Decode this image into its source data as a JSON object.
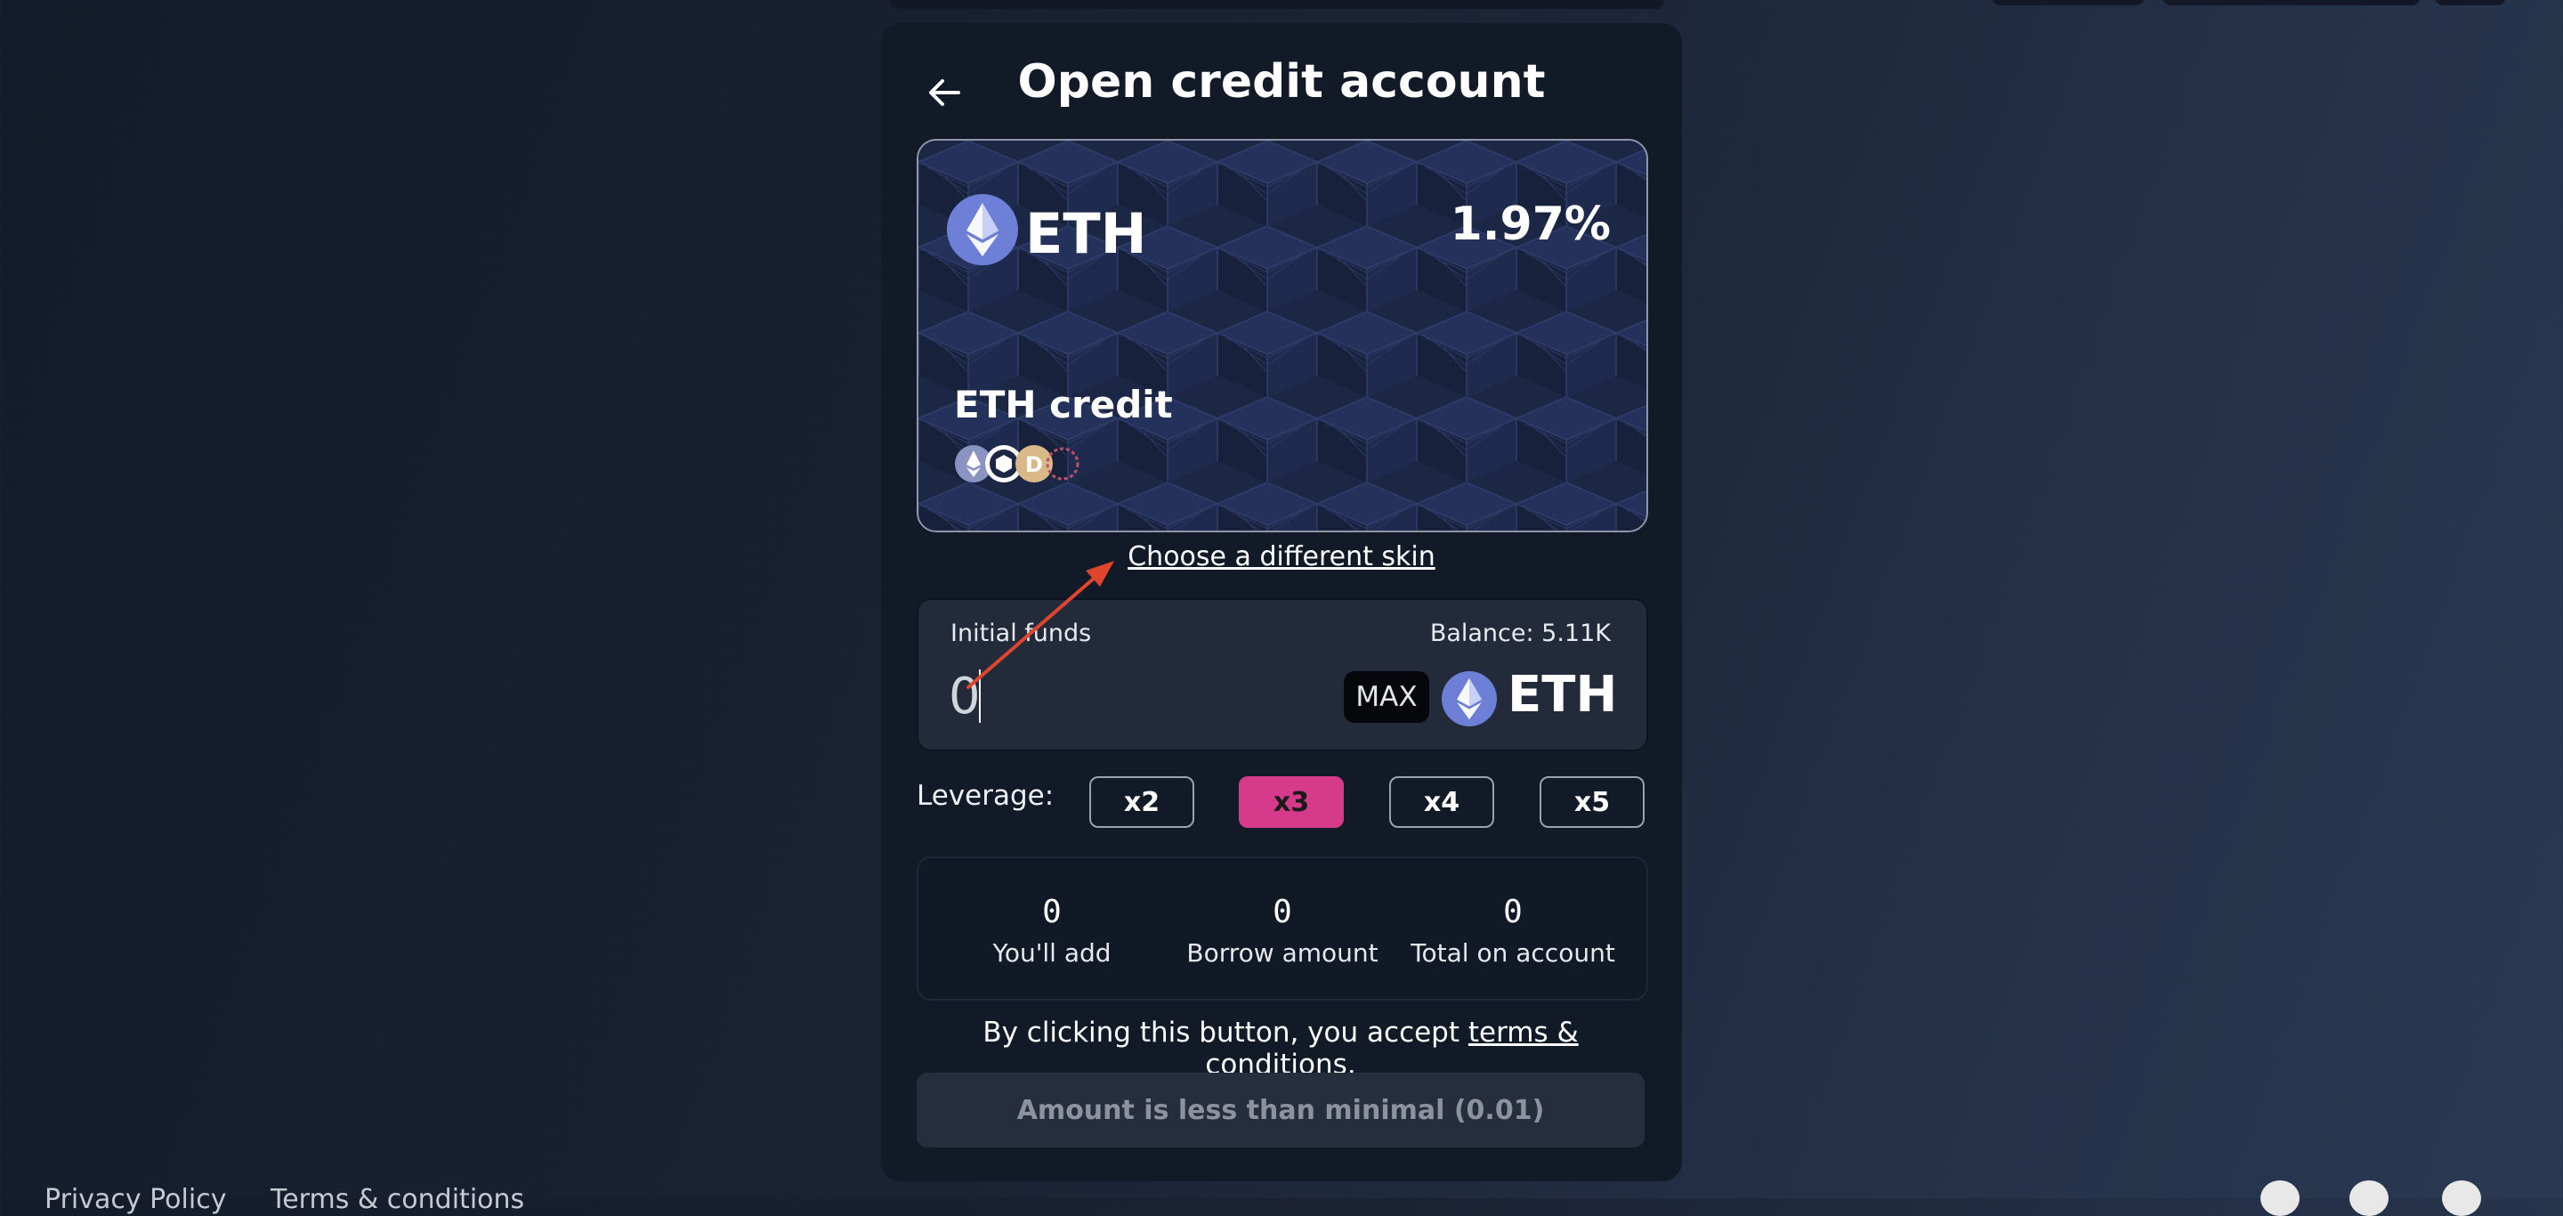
{
  "header": {
    "title": "Open credit account",
    "back_icon": "arrow-left-icon"
  },
  "card": {
    "asset": "ETH",
    "apy": "1.97%",
    "credit_name": "ETH credit",
    "skin_link": "Choose a different skin",
    "background_color": "#1e2a4a"
  },
  "funds": {
    "label": "Initial funds",
    "balance": "Balance: 5.11K",
    "value": "0",
    "max_label": "MAX",
    "token": "ETH"
  },
  "leverage": {
    "label": "Leverage:",
    "options": [
      "x2",
      "x3",
      "x4",
      "x5"
    ],
    "selected": "x3",
    "accent_color": "#d63a8a"
  },
  "summary": {
    "items": [
      {
        "value": "0",
        "label": "You'll add"
      },
      {
        "value": "0",
        "label": "Borrow amount"
      },
      {
        "value": "0",
        "label": "Total on account"
      }
    ]
  },
  "terms": {
    "prefix": "By clicking this button, you accept ",
    "link": "terms & conditions",
    "suffix": "."
  },
  "submit": {
    "label": "Amount is less than minimal (0.01)"
  },
  "footer": {
    "links": [
      "Privacy Policy",
      "Terms & conditions"
    ]
  }
}
